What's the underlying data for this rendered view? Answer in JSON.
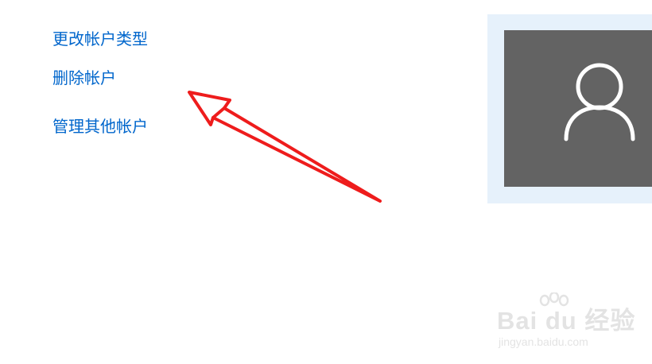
{
  "account": {
    "top_text": " ",
    "links": {
      "change_type": "更改帐户类型",
      "delete": "删除帐户",
      "manage_other": "管理其他帐户"
    },
    "avatar_icon": "user-silhouette-icon"
  },
  "annotation": {
    "color": "#ee1c1c",
    "icon": "red-arrow-icon"
  },
  "watermark": {
    "logo": "Bai du 经验",
    "url": "jingyan.baidu.com"
  },
  "colors": {
    "link": "#0066cc",
    "avatar_bg": "#636363",
    "avatar_frame": "#e6f1fb"
  }
}
